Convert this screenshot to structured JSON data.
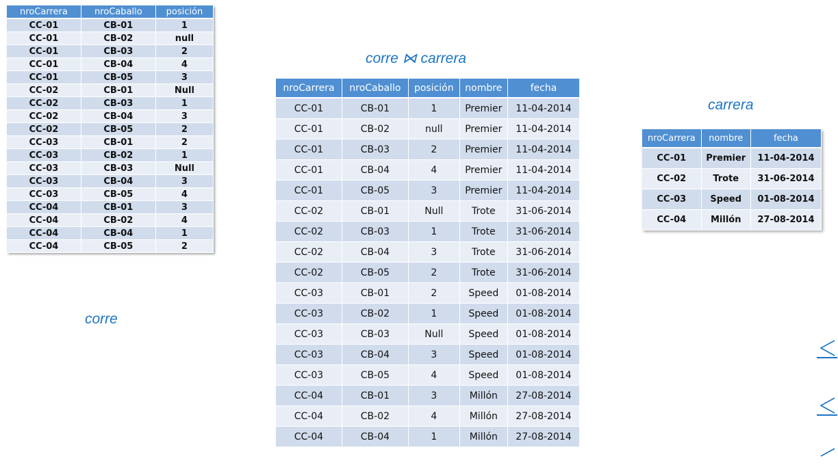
{
  "captions": {
    "corre": "corre",
    "join": "corre ⋈ carrera",
    "carrera": "carrera"
  },
  "corre_table": {
    "headers": [
      "nroCarrera",
      "nroCaballo",
      "posición"
    ],
    "rows": [
      [
        "CC-01",
        "CB-01",
        "1"
      ],
      [
        "CC-01",
        "CB-02",
        "null"
      ],
      [
        "CC-01",
        "CB-03",
        "2"
      ],
      [
        "CC-01",
        "CB-04",
        "4"
      ],
      [
        "CC-01",
        "CB-05",
        "3"
      ],
      [
        "CC-02",
        "CB-01",
        "Null"
      ],
      [
        "CC-02",
        "CB-03",
        "1"
      ],
      [
        "CC-02",
        "CB-04",
        "3"
      ],
      [
        "CC-02",
        "CB-05",
        "2"
      ],
      [
        "CC-03",
        "CB-01",
        "2"
      ],
      [
        "CC-03",
        "CB-02",
        "1"
      ],
      [
        "CC-03",
        "CB-03",
        "Null"
      ],
      [
        "CC-03",
        "CB-04",
        "3"
      ],
      [
        "CC-03",
        "CB-05",
        "4"
      ],
      [
        "CC-04",
        "CB-01",
        "3"
      ],
      [
        "CC-04",
        "CB-02",
        "4"
      ],
      [
        "CC-04",
        "CB-04",
        "1"
      ],
      [
        "CC-04",
        "CB-05",
        "2"
      ]
    ]
  },
  "join_table": {
    "headers": [
      "nroCarrera",
      "nroCaballo",
      "posición",
      "nombre",
      "fecha"
    ],
    "rows": [
      [
        "CC-01",
        "CB-01",
        "1",
        "Premier",
        "11-04-2014"
      ],
      [
        "CC-01",
        "CB-02",
        "null",
        "Premier",
        "11-04-2014"
      ],
      [
        "CC-01",
        "CB-03",
        "2",
        "Premier",
        "11-04-2014"
      ],
      [
        "CC-01",
        "CB-04",
        "4",
        "Premier",
        "11-04-2014"
      ],
      [
        "CC-01",
        "CB-05",
        "3",
        "Premier",
        "11-04-2014"
      ],
      [
        "CC-02",
        "CB-01",
        "Null",
        "Trote",
        "31-06-2014"
      ],
      [
        "CC-02",
        "CB-03",
        "1",
        "Trote",
        "31-06-2014"
      ],
      [
        "CC-02",
        "CB-04",
        "3",
        "Trote",
        "31-06-2014"
      ],
      [
        "CC-02",
        "CB-05",
        "2",
        "Trote",
        "31-06-2014"
      ],
      [
        "CC-03",
        "CB-01",
        "2",
        "Speed",
        "01-08-2014"
      ],
      [
        "CC-03",
        "CB-02",
        "1",
        "Speed",
        "01-08-2014"
      ],
      [
        "CC-03",
        "CB-03",
        "Null",
        "Speed",
        "01-08-2014"
      ],
      [
        "CC-03",
        "CB-04",
        "3",
        "Speed",
        "01-08-2014"
      ],
      [
        "CC-03",
        "CB-05",
        "4",
        "Speed",
        "01-08-2014"
      ],
      [
        "CC-04",
        "CB-01",
        "3",
        "Millón",
        "27-08-2014"
      ],
      [
        "CC-04",
        "CB-02",
        "4",
        "Millón",
        "27-08-2014"
      ],
      [
        "CC-04",
        "CB-04",
        "1",
        "Millón",
        "27-08-2014"
      ]
    ]
  },
  "carrera_table": {
    "headers": [
      "nroCarrera",
      "nombre",
      "fecha"
    ],
    "rows": [
      [
        "CC-01",
        "Premier",
        "11-04-2014"
      ],
      [
        "CC-02",
        "Trote",
        "31-06-2014"
      ],
      [
        "CC-03",
        "Speed",
        "01-08-2014"
      ],
      [
        "CC-04",
        "Millón",
        "27-08-2014"
      ]
    ]
  },
  "nav_icons": [
    "previous-slide-icon",
    "back-icon",
    "return-icon"
  ],
  "colors": {
    "header_bg": "#4f8fd2",
    "row_odd": "#d0dcec",
    "row_even": "#e9eef6",
    "caption": "#1b74c4"
  }
}
